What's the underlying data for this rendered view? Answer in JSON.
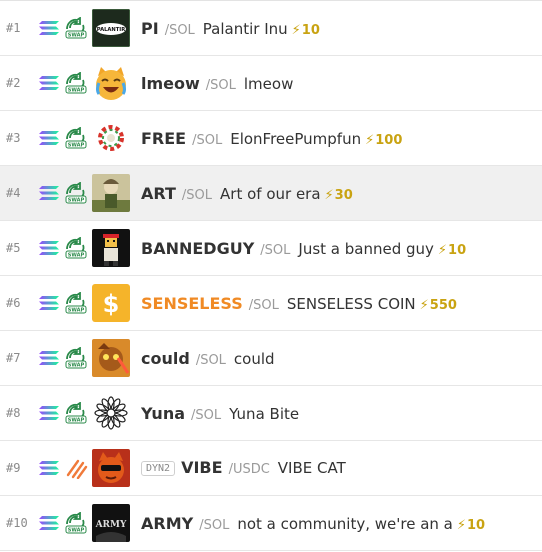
{
  "rows": [
    {
      "rank": "#1",
      "badge": "",
      "symbol": "PI",
      "quote": "/SOL",
      "name": "Palantir Inu",
      "boost": "10",
      "dex": "swap",
      "avatar": "palantir",
      "avatar_text": "PALANTIR",
      "highlight": false
    },
    {
      "rank": "#2",
      "badge": "",
      "symbol": "lmeow",
      "quote": "/SOL",
      "name": "lmeow",
      "boost": "",
      "dex": "swap",
      "avatar": "cat",
      "highlight": false
    },
    {
      "rank": "#3",
      "badge": "",
      "symbol": "FREE",
      "quote": "/SOL",
      "name": "ElonFreePumpfun",
      "boost": "100",
      "dex": "swap",
      "avatar": "wreath",
      "highlight": false
    },
    {
      "rank": "#4",
      "badge": "",
      "symbol": "ART",
      "quote": "/SOL",
      "name": "Art of our era",
      "boost": "30",
      "dex": "swap",
      "avatar": "art",
      "highlight": true
    },
    {
      "rank": "#5",
      "badge": "",
      "symbol": "BANNEDGUY",
      "quote": "/SOL",
      "name": "Just a banned guy",
      "boost": "10",
      "dex": "swap",
      "avatar": "guy",
      "highlight": false
    },
    {
      "rank": "#6",
      "badge": "",
      "symbol": "SENSELESS",
      "quote": "/SOL",
      "name": "SENSELESS COIN",
      "boost": "550",
      "dex": "swap",
      "avatar": "dollar",
      "avatar_text": "$",
      "highlight": false,
      "symbol_color": "#f08a24"
    },
    {
      "rank": "#7",
      "badge": "",
      "symbol": "could",
      "quote": "/SOL",
      "name": "could",
      "boost": "",
      "dex": "swap",
      "avatar": "could",
      "highlight": false
    },
    {
      "rank": "#8",
      "badge": "",
      "symbol": "Yuna",
      "quote": "/SOL",
      "name": "Yuna Bite",
      "boost": "",
      "dex": "swap",
      "avatar": "flower",
      "highlight": false
    },
    {
      "rank": "#9",
      "badge": "DYN2",
      "symbol": "VIBE",
      "quote": "/USDC",
      "name": "VIBE CAT",
      "boost": "",
      "dex": "stripes",
      "avatar": "vibe",
      "highlight": false
    },
    {
      "rank": "#10",
      "badge": "",
      "symbol": "ARMY",
      "quote": "/SOL",
      "name": "not a community, we're an a",
      "boost": "10",
      "dex": "swap",
      "avatar": "army",
      "avatar_text": "ARMY",
      "highlight": false
    }
  ],
  "icons": {
    "chain": "solana-icon",
    "swap": "swap-icon",
    "stripes": "dex-stripes-icon",
    "boost": "bolt-icon"
  },
  "colors": {
    "boost": "#c9a312",
    "quote": "#9a9a9a",
    "highlight_bg": "#f0f0f0",
    "senseless": "#f08a24"
  }
}
